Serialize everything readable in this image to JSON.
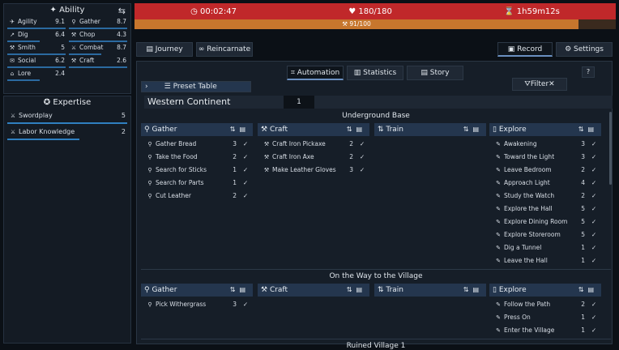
{
  "ability": {
    "title": "Ability",
    "items": [
      {
        "name": "Agility",
        "value": "9.1",
        "icon": "✈"
      },
      {
        "name": "Gather",
        "value": "8.7",
        "icon": "⚲"
      },
      {
        "name": "Dig",
        "value": "6.4",
        "icon": "↗"
      },
      {
        "name": "Chop",
        "value": "4.3",
        "icon": "⚒"
      },
      {
        "name": "Smith",
        "value": "5",
        "icon": "⚒"
      },
      {
        "name": "Combat",
        "value": "8.7",
        "icon": "⚔"
      },
      {
        "name": "Social",
        "value": "6.2",
        "icon": "✉"
      },
      {
        "name": "Craft",
        "value": "2.6",
        "icon": "⚒"
      },
      {
        "name": "Lore",
        "value": "2.4",
        "icon": "⌂"
      }
    ]
  },
  "expertise": {
    "title": "Expertise",
    "items": [
      {
        "name": "Swordplay",
        "value": "5"
      },
      {
        "name": "Labor Knowledge",
        "value": "2"
      }
    ]
  },
  "status": {
    "time": "00:02:47",
    "hp": "180/180",
    "timer": "1h59m12s",
    "xp": "91/100"
  },
  "nav": {
    "journey": "Journey",
    "reincarnate": "Reincarnate",
    "record": "Record",
    "settings": "Settings"
  },
  "tabs": {
    "automation": "Automation",
    "statistics": "Statistics",
    "story": "Story"
  },
  "preset": "Preset Table",
  "filter": "Filter",
  "continent": {
    "name": "Western Continent",
    "num": "1"
  },
  "sections": [
    {
      "title": "Underground Base",
      "gather": [
        {
          "t": "Gather Bread",
          "n": "3"
        },
        {
          "t": "Take the Food",
          "n": "2"
        },
        {
          "t": "Search for Sticks",
          "n": "1"
        },
        {
          "t": "Search for Parts",
          "n": "1"
        },
        {
          "t": "Cut Leather",
          "n": "2"
        }
      ],
      "craft": [
        {
          "t": "Craft Iron Pickaxe",
          "n": "2"
        },
        {
          "t": "Craft Iron Axe",
          "n": "2"
        },
        {
          "t": "Make Leather Gloves",
          "n": "3"
        }
      ],
      "explore": [
        {
          "t": "Awakening",
          "n": "3"
        },
        {
          "t": "Toward the Light",
          "n": "3"
        },
        {
          "t": "Leave Bedroom",
          "n": "2"
        },
        {
          "t": "Approach Light",
          "n": "4"
        },
        {
          "t": "Study the Watch",
          "n": "2"
        },
        {
          "t": "Explore the Hall",
          "n": "5"
        },
        {
          "t": "Explore Dining Room",
          "n": "5"
        },
        {
          "t": "Explore Storeroom",
          "n": "5"
        },
        {
          "t": "Dig a Tunnel",
          "n": "1"
        },
        {
          "t": "Leave the Hall",
          "n": "1"
        }
      ]
    },
    {
      "title": "On the Way to the Village",
      "gather": [
        {
          "t": "Pick Withergrass",
          "n": "3"
        }
      ],
      "craft": [],
      "explore": [
        {
          "t": "Follow the Path",
          "n": "2"
        },
        {
          "t": "Press On",
          "n": "1"
        },
        {
          "t": "Enter the Village",
          "n": "1"
        }
      ]
    },
    {
      "title": "Ruined Village 1"
    }
  ],
  "cols": {
    "gather": "Gather",
    "craft": "Craft",
    "train": "Train",
    "explore": "Explore"
  }
}
